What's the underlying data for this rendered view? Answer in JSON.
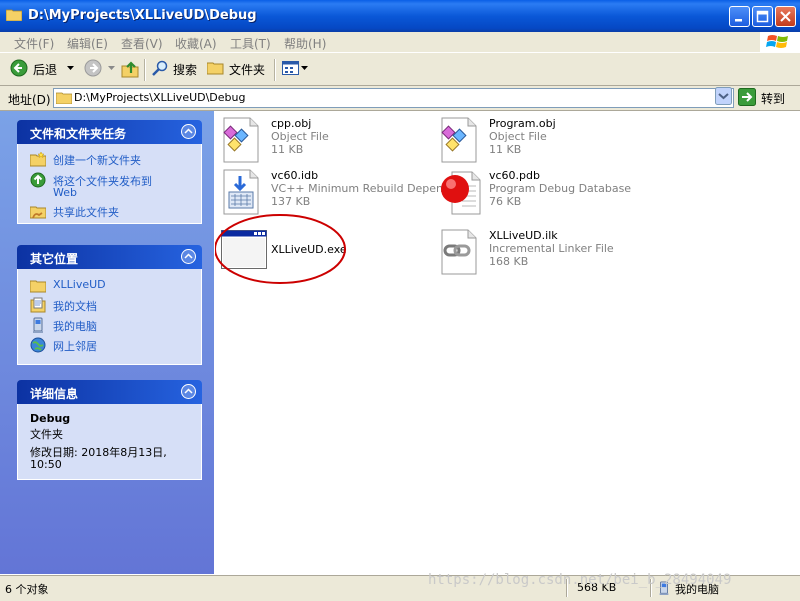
{
  "window": {
    "title": "D:\\MyProjects\\XLLiveUD\\Debug"
  },
  "menu": [
    "文件(F)",
    "编辑(E)",
    "查看(V)",
    "收藏(A)",
    "工具(T)",
    "帮助(H)"
  ],
  "toolbar": {
    "back": "后退",
    "search": "搜索",
    "folders": "文件夹"
  },
  "address": {
    "label": "地址(D)",
    "value": "D:\\MyProjects\\XLLiveUD\\Debug",
    "go": "转到"
  },
  "tasks": {
    "title": "文件和文件夹任务",
    "items": [
      "创建一个新文件夹",
      "将这个文件夹发布到",
      "Web",
      "共享此文件夹"
    ]
  },
  "places": {
    "title": "其它位置",
    "items": [
      "XLLiveUD",
      "我的文档",
      "我的电脑",
      "网上邻居"
    ]
  },
  "details": {
    "title": "详细信息",
    "name": "Debug",
    "type": "文件夹",
    "modified_line1": "修改日期: 2018年8月13日,",
    "modified_line2": "10:50"
  },
  "files": [
    {
      "name": "cpp.obj",
      "type": "Object File",
      "size": "11 KB",
      "icon": "object-file-icon"
    },
    {
      "name": "Program.obj",
      "type": "Object File",
      "size": "11 KB",
      "icon": "object-file-icon"
    },
    {
      "name": "vc60.idb",
      "type": "VC++ Minimum Rebuild Depen...",
      "size": "137 KB",
      "icon": "idb-file-icon"
    },
    {
      "name": "vc60.pdb",
      "type": "Program Debug Database",
      "size": "76 KB",
      "icon": "pdb-file-icon"
    },
    {
      "name": "XLLiveUD.exe",
      "type": "",
      "size": "",
      "icon": "exe-window-icon"
    },
    {
      "name": "XLLiveUD.ilk",
      "type": "Incremental Linker File",
      "size": "168 KB",
      "icon": "ilk-file-icon"
    }
  ],
  "status": {
    "objects": "6 个对象",
    "size": "568 KB",
    "location": "我的电脑"
  },
  "watermark": "https://blog.csdn.net/bei_b_28494049",
  "colors": {
    "title_bar": "#0a58d8",
    "task_pane": "#7ba2e7",
    "link": "#215dc6",
    "highlight_ellipse": "#cc0000"
  }
}
